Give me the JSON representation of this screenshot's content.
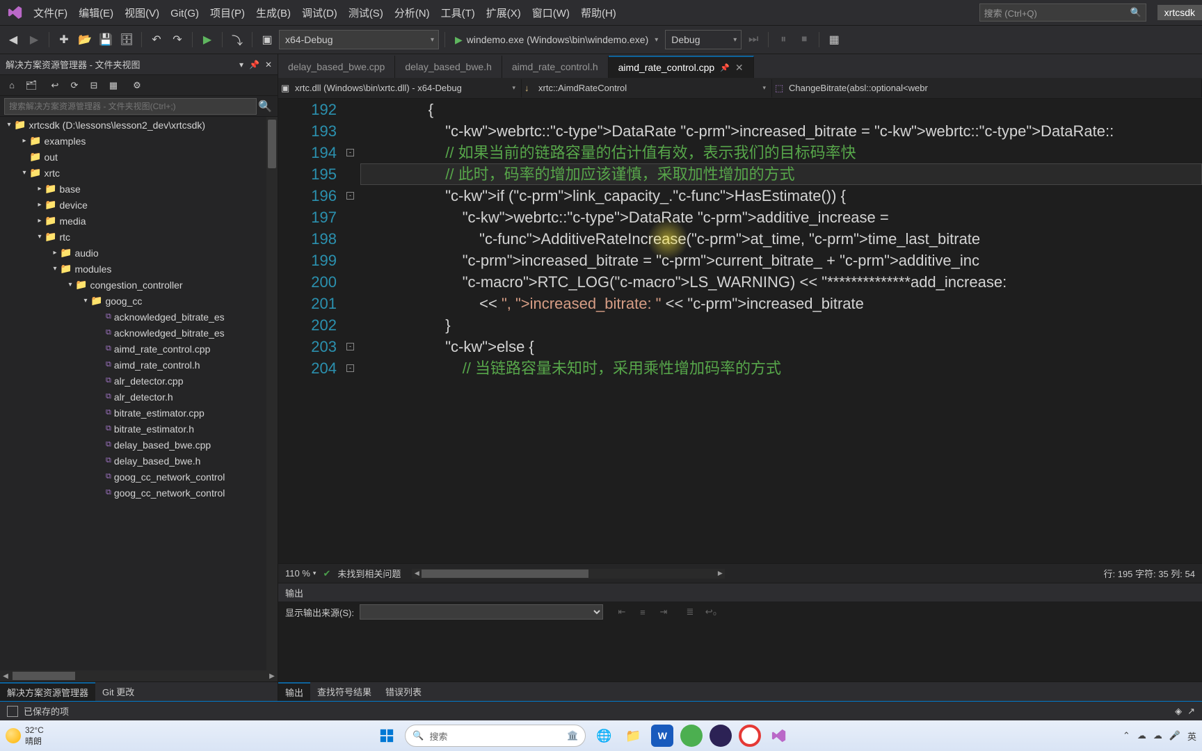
{
  "menu": {
    "items": [
      "文件(F)",
      "编辑(E)",
      "视图(V)",
      "Git(G)",
      "项目(P)",
      "生成(B)",
      "调试(D)",
      "测试(S)",
      "分析(N)",
      "工具(T)",
      "扩展(X)",
      "窗口(W)",
      "帮助(H)"
    ],
    "search_placeholder": "搜索 (Ctrl+Q)",
    "sdk_badge": "xrtcsdk"
  },
  "toolbar": {
    "config": "x64-Debug",
    "run_target": "windemo.exe (Windows\\bin\\windemo.exe)",
    "debug_mode": "Debug"
  },
  "sidebar": {
    "title": "解决方案资源管理器 - 文件夹视图",
    "search_placeholder": "搜索解决方案资源管理器 - 文件夹视图(Ctrl+;)",
    "tree": [
      {
        "indent": 0,
        "tw": "▾",
        "icon": "folder",
        "label": "xrtcsdk (D:\\lessons\\lesson2_dev\\xrtcsdk)"
      },
      {
        "indent": 1,
        "tw": "▸",
        "icon": "folder",
        "label": "examples"
      },
      {
        "indent": 1,
        "tw": "",
        "icon": "folder",
        "label": "out"
      },
      {
        "indent": 1,
        "tw": "▾",
        "icon": "folder",
        "label": "xrtc"
      },
      {
        "indent": 2,
        "tw": "▸",
        "icon": "folder",
        "label": "base"
      },
      {
        "indent": 2,
        "tw": "▸",
        "icon": "folder",
        "label": "device"
      },
      {
        "indent": 2,
        "tw": "▸",
        "icon": "folder",
        "label": "media"
      },
      {
        "indent": 2,
        "tw": "▾",
        "icon": "folder",
        "label": "rtc"
      },
      {
        "indent": 3,
        "tw": "▸",
        "icon": "folder",
        "label": "audio"
      },
      {
        "indent": 3,
        "tw": "▾",
        "icon": "folder",
        "label": "modules"
      },
      {
        "indent": 4,
        "tw": "▾",
        "icon": "folder",
        "label": "congestion_controller"
      },
      {
        "indent": 5,
        "tw": "▾",
        "icon": "folder",
        "label": "goog_cc"
      },
      {
        "indent": 6,
        "tw": "",
        "icon": "file",
        "label": "acknowledged_bitrate_es"
      },
      {
        "indent": 6,
        "tw": "",
        "icon": "file",
        "label": "acknowledged_bitrate_es"
      },
      {
        "indent": 6,
        "tw": "",
        "icon": "file",
        "label": "aimd_rate_control.cpp"
      },
      {
        "indent": 6,
        "tw": "",
        "icon": "file",
        "label": "aimd_rate_control.h"
      },
      {
        "indent": 6,
        "tw": "",
        "icon": "file",
        "label": "alr_detector.cpp"
      },
      {
        "indent": 6,
        "tw": "",
        "icon": "file",
        "label": "alr_detector.h"
      },
      {
        "indent": 6,
        "tw": "",
        "icon": "file",
        "label": "bitrate_estimator.cpp"
      },
      {
        "indent": 6,
        "tw": "",
        "icon": "file",
        "label": "bitrate_estimator.h"
      },
      {
        "indent": 6,
        "tw": "",
        "icon": "file",
        "label": "delay_based_bwe.cpp"
      },
      {
        "indent": 6,
        "tw": "",
        "icon": "file",
        "label": "delay_based_bwe.h"
      },
      {
        "indent": 6,
        "tw": "",
        "icon": "file",
        "label": "goog_cc_network_control"
      },
      {
        "indent": 6,
        "tw": "",
        "icon": "file",
        "label": "goog_cc_network_control"
      }
    ],
    "bottom_tabs": [
      "解决方案资源管理器",
      "Git 更改"
    ]
  },
  "editor": {
    "tabs": [
      {
        "label": "delay_based_bwe.cpp",
        "active": false
      },
      {
        "label": "delay_based_bwe.h",
        "active": false
      },
      {
        "label": "aimd_rate_control.h",
        "active": false
      },
      {
        "label": "aimd_rate_control.cpp",
        "active": true
      }
    ],
    "nav": {
      "project": "xrtc.dll (Windows\\bin\\xrtc.dll) - x64-Debug",
      "scope": "xrtc::AimdRateControl",
      "member": "ChangeBitrate(absl::optional<webr"
    },
    "first_line": 192,
    "lines": [
      "                {",
      "                    webrtc::DataRate increased_bitrate = webrtc::DataRate::",
      "                    // 如果当前的链路容量的估计值有效，表示我们的目标码率快",
      "                    // 此时，码率的增加应该谨慎，采取加性增加的方式",
      "                    if (link_capacity_.HasEstimate()) {",
      "                        webrtc::DataRate additive_increase =",
      "                            AdditiveRateIncrease(at_time, time_last_bitrate",
      "                        increased_bitrate = current_bitrate_ + additive_inc",
      "                        RTC_LOG(LS_WARNING) << \"**************add_increase:",
      "                            << \", increased_bitrate: \" << increased_bitrate",
      "                    }",
      "                    else {",
      "                        // 当链路容量未知时，采用乘性增加码率的方式"
    ],
    "current_row_index": 3,
    "zoom": "110 %",
    "issues": "未找到相关问题",
    "caret": "行: 195    字符: 35    列: 54"
  },
  "output": {
    "title": "输出",
    "source_label": "显示输出来源(S):",
    "tabs": [
      "输出",
      "查找符号结果",
      "错误列表"
    ]
  },
  "statusbar": {
    "saved": "已保存的项"
  },
  "taskbar": {
    "temp": "32°C",
    "cond": "晴朗",
    "search_placeholder": "搜索",
    "ime": "英"
  }
}
